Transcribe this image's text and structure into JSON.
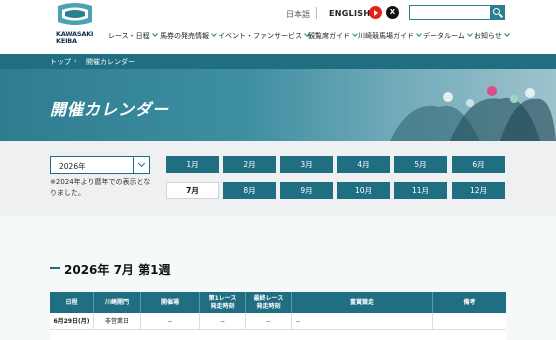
{
  "header": {
    "logo_text": "KAWASAKI KEIBA",
    "lang_ja": "日本語",
    "lang_en": "ENGLISH",
    "x_label": "X",
    "search_placeholder": ""
  },
  "nav": [
    {
      "label": "レース・日程"
    },
    {
      "label": "馬券の発売情報"
    },
    {
      "label": "イベント・ファンサービス"
    },
    {
      "label": "観覧席ガイド"
    },
    {
      "label": "川崎競馬場ガイド"
    },
    {
      "label": "データルーム"
    },
    {
      "label": "お知らせ"
    }
  ],
  "breadcrumb": {
    "home": "トップ",
    "sep": "›",
    "current": "開催カレンダー"
  },
  "hero": {
    "title": "開催カレンダー"
  },
  "year_selector": {
    "value": "2026年"
  },
  "note": "※2024年より暦年での表示となりました。",
  "months": [
    "1月",
    "2月",
    "3月",
    "4月",
    "5月",
    "6月",
    "7月",
    "8月",
    "9月",
    "10月",
    "11月",
    "12月"
  ],
  "active_month": "7月",
  "week": {
    "title": "2026年 7月 第1週"
  },
  "table": {
    "headers": [
      "日程",
      "川崎開門",
      "開催場",
      "第1レース\n発走時刻",
      "最終レース\n発走時刻",
      "重賞競走",
      "備考"
    ],
    "rows": [
      [
        "6月29日(月)",
        "非営業日",
        "--",
        "--",
        "--",
        "--",
        ""
      ]
    ]
  },
  "colors": {
    "brand": "#1f6e82",
    "accent_red": "#e62117"
  }
}
